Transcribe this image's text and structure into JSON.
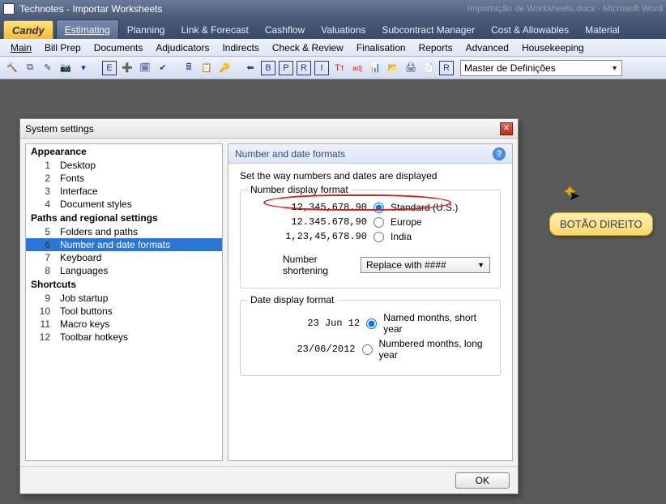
{
  "window": {
    "title": "Technotes - Importar Worksheets",
    "ghost_right": "Importação de Worksheets.docx · Microsoft Word"
  },
  "modules": {
    "brand": "Candy",
    "tabs": [
      "Estimating",
      "Planning",
      "Link & Forecast",
      "Cashflow",
      "Valuations",
      "Subcontract Manager",
      "Cost & Allowables",
      "Material"
    ]
  },
  "menus": [
    "Main",
    "Bill Prep",
    "Documents",
    "Adjudicators",
    "Indirects",
    "Check & Review",
    "Finalisation",
    "Reports",
    "Advanced",
    "Housekeeping"
  ],
  "toolbar": {
    "combo": "Master de Definições"
  },
  "dialog": {
    "title": "System settings",
    "ok": "OK",
    "tree": {
      "g1": {
        "title": "Appearance",
        "items": [
          {
            "n": "1",
            "label": "Desktop"
          },
          {
            "n": "2",
            "label": "Fonts"
          },
          {
            "n": "3",
            "label": "Interface"
          },
          {
            "n": "4",
            "label": "Document styles"
          }
        ]
      },
      "g2": {
        "title": "Paths and regional settings",
        "items": [
          {
            "n": "5",
            "label": "Folders and paths"
          },
          {
            "n": "6",
            "label": "Number and date formats"
          },
          {
            "n": "7",
            "label": "Keyboard"
          },
          {
            "n": "8",
            "label": "Languages"
          }
        ]
      },
      "g3": {
        "title": "Shortcuts",
        "items": [
          {
            "n": "9",
            "label": "Job startup"
          },
          {
            "n": "10",
            "label": "Tool buttons"
          },
          {
            "n": "11",
            "label": "Macro keys"
          },
          {
            "n": "12",
            "label": "Toolbar hotkeys"
          }
        ]
      }
    },
    "content": {
      "heading": "Number and date formats",
      "desc": "Set the way numbers and dates are displayed",
      "num_group_label": "Number display format",
      "num_options": [
        {
          "sample": "12,345,678.90",
          "label": "Standard (U.S.)"
        },
        {
          "sample": "12.345.678,90",
          "label": "Europe"
        },
        {
          "sample": "1,23,45,678.90",
          "label": "India"
        }
      ],
      "shortening_label": "Number shortening",
      "shortening_value": "Replace with ####",
      "date_group_label": "Date display format",
      "date_options": [
        {
          "sample": "23 Jun 12",
          "label": "Named months, short year"
        },
        {
          "sample": "23/06/2012",
          "label": "Numbered months, long year"
        }
      ]
    }
  },
  "annotation": {
    "balloon": "BOTÃO DIREITO"
  }
}
